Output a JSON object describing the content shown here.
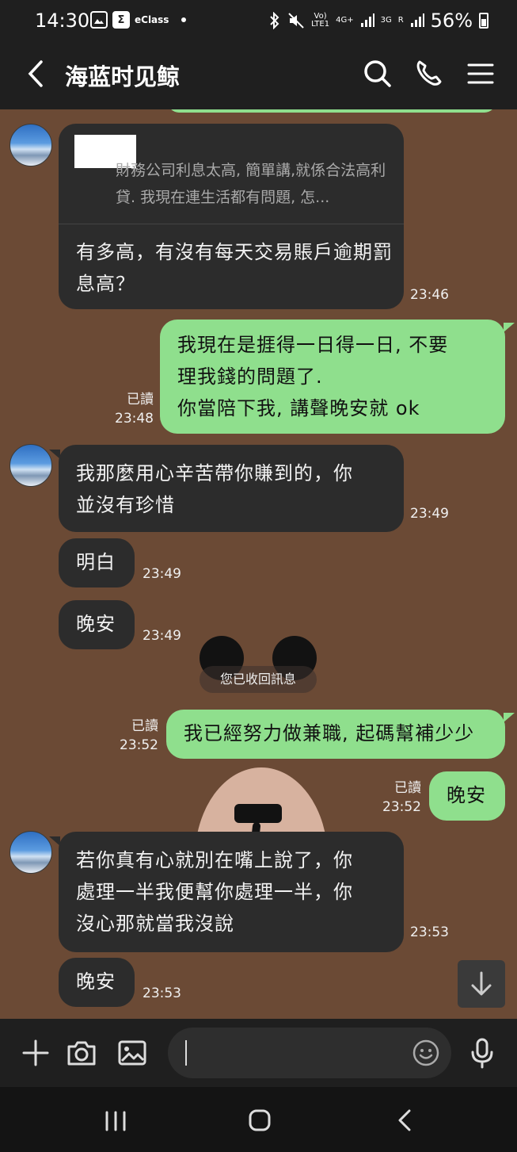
{
  "status_bar": {
    "time": "14:30",
    "eclass_label": "eClass",
    "network_label_1": "Vo)",
    "network_label_2": "LTE1",
    "network_label_3": "4G+",
    "network_label_4": "3G",
    "network_label_5": "R",
    "battery": "56%"
  },
  "header": {
    "title": "海蓝时见鲸"
  },
  "chat": {
    "quoted_message": {
      "quote_text": "財務公司利息太高, 簡單講,就係合法高利貸. 我現在連生活都有問題, 怎...",
      "reply_text": "有多高，有沒有每天交易賬戶逾期罰息高？",
      "time": "23:46"
    },
    "msg_out_1": {
      "text_line1": "我現在是捱得一日得一日, 不要",
      "text_line2": "理我錢的問題了.",
      "text_line3": "你當陪下我, 講聲晚安就 ok",
      "read": "已讀",
      "time": "23:48"
    },
    "msg_in_2": {
      "text_line1": "我那麼用心辛苦帶你賺到的，你",
      "text_line2": "並沒有珍惜",
      "time": "23:49"
    },
    "msg_in_3": {
      "text": "明白",
      "time": "23:49"
    },
    "msg_in_4": {
      "text": "晚安",
      "time": "23:49"
    },
    "recalled_notice": "您已收回訊息",
    "msg_out_5": {
      "text": "我已經努力做兼職, 起碼幫補少少",
      "read": "已讀",
      "time": "23:52"
    },
    "msg_out_6": {
      "text": "晚安",
      "read": "已讀",
      "time": "23:52"
    },
    "msg_in_7": {
      "text_line1": "若你真有心就別在嘴上說了，你",
      "text_line2": "處理一半我便幫你處理一半，你",
      "text_line3": "沒心那就當我沒說",
      "time": "23:53"
    },
    "msg_in_8": {
      "text": "晚安",
      "time": "23:53"
    }
  },
  "colors": {
    "background": "#6b4a35",
    "incoming_bubble": "#2c2c2c",
    "outgoing_bubble": "#8fdf8d",
    "bar": "#1f1f1f"
  }
}
